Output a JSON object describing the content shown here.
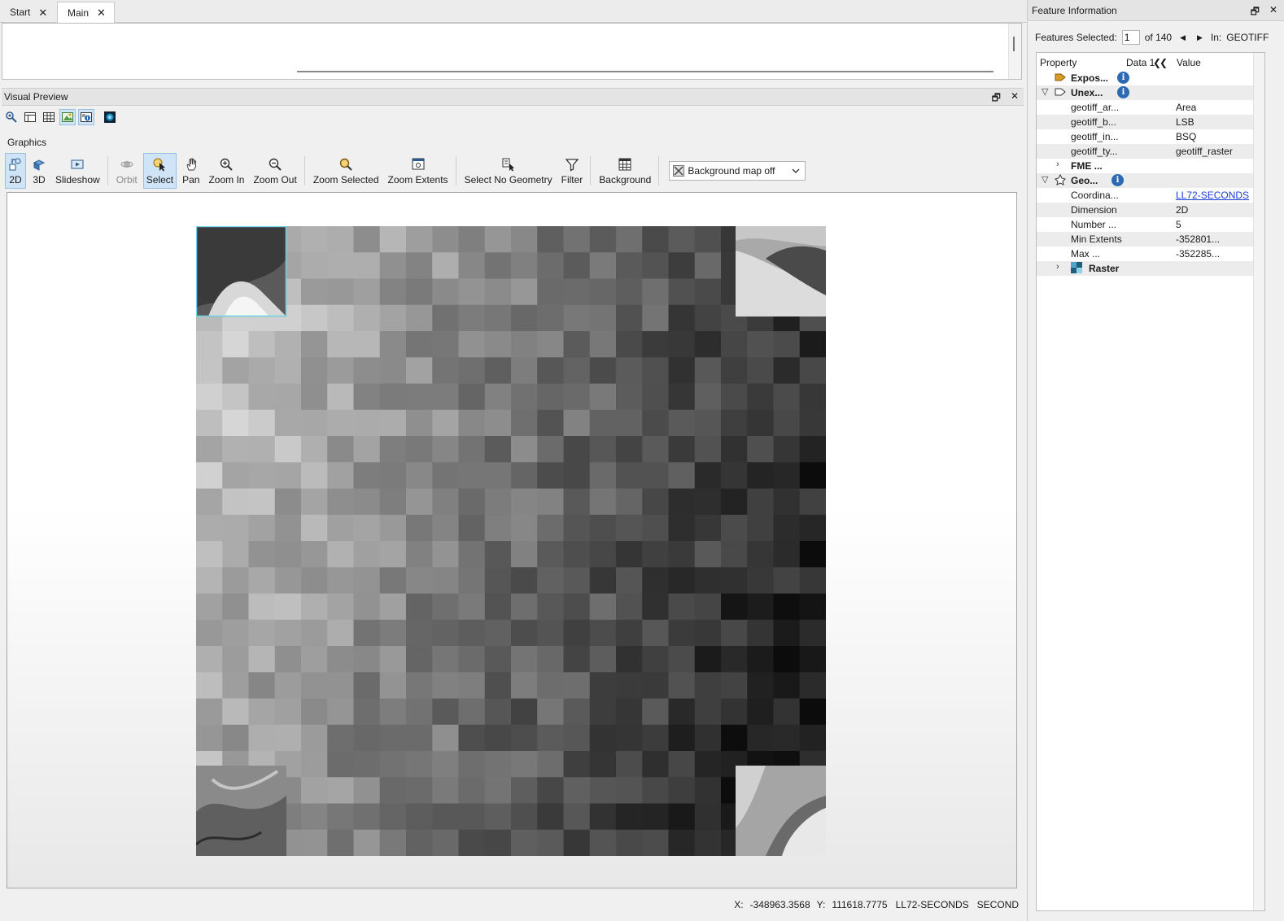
{
  "tabs": [
    {
      "label": "Start",
      "active": false
    },
    {
      "label": "Main",
      "active": true
    }
  ],
  "visual_preview": {
    "title": "Visual Preview",
    "graphics_label": "Graphics",
    "toolbar": {
      "btn_2d": "2D",
      "btn_3d": "3D",
      "btn_slideshow": "Slideshow",
      "btn_orbit": "Orbit",
      "btn_select": "Select",
      "btn_pan": "Pan",
      "btn_zoom_in": "Zoom In",
      "btn_zoom_out": "Zoom Out",
      "btn_zoom_selected": "Zoom Selected",
      "btn_zoom_extents": "Zoom Extents",
      "btn_select_no_geometry": "Select No Geometry",
      "btn_filter": "Filter",
      "btn_background": "Background",
      "background_map_value": "Background map off"
    }
  },
  "status_bar": {
    "x_label": "X:",
    "x_value": "-348963.3568",
    "y_label": "Y:",
    "y_value": "111618.7775",
    "coordsys": "LL72-SECONDS",
    "units": "SECOND"
  },
  "feature_info": {
    "title": "Feature Information",
    "features_selected_label": "Features Selected:",
    "features_selected_value": "1",
    "of_total": "of 140",
    "in_label": "In:",
    "in_value": "GEOTIFF",
    "col_property": "Property",
    "col_data": "Data 1",
    "col_value": "Value",
    "rows": [
      {
        "property": "Expos...",
        "value": "",
        "bold": true
      },
      {
        "property": "Unex...",
        "value": "",
        "bold": true
      },
      {
        "property": "geotiff_ar...",
        "value": "Area"
      },
      {
        "property": "geotiff_b...",
        "value": "LSB"
      },
      {
        "property": "geotiff_in...",
        "value": "BSQ"
      },
      {
        "property": "geotiff_ty...",
        "value": "geotiff_raster"
      },
      {
        "property": "FME ...",
        "value": "",
        "bold": true
      },
      {
        "property": "Geo...",
        "value": "",
        "bold": true
      },
      {
        "property": "Coordina...",
        "value": "LL72-SECONDS"
      },
      {
        "property": "Dimension",
        "value": "2D"
      },
      {
        "property": "Number ...",
        "value": "5"
      },
      {
        "property": "Min Extents",
        "value": "-352801..."
      },
      {
        "property": "Max ...",
        "value": "-352285..."
      },
      {
        "property": "Raster",
        "value": "",
        "bold": true
      }
    ]
  },
  "colors": {
    "accent_select": "#cfe4f7",
    "info_icon": "#2a6ab3",
    "link": "#1a3fd6"
  }
}
